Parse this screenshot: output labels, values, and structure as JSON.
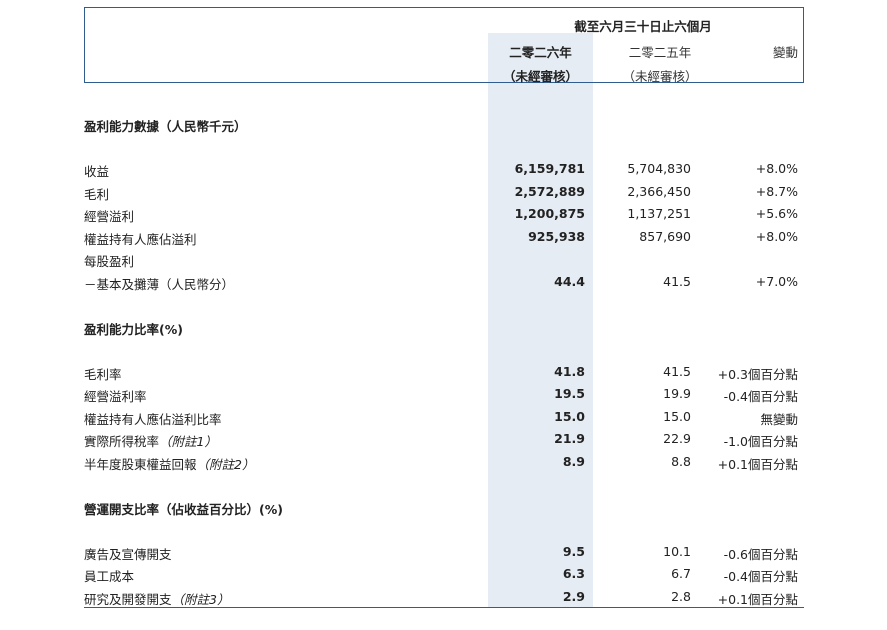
{
  "header": {
    "period": "截至六月三十日止六個月",
    "col_current": "二零二六年",
    "col_current_sub": "（未經審核）",
    "col_prior": "二零二五年",
    "col_prior_sub": "（未經審核）",
    "col_change": "變動"
  },
  "sections": [
    {
      "title": "盈利能力數據（人民幣千元）",
      "rows": [
        {
          "label": "收益",
          "note": "",
          "current": "6,159,781",
          "prior": "5,704,830",
          "change": "+8.0%"
        },
        {
          "label": "毛利",
          "note": "",
          "current": "2,572,889",
          "prior": "2,366,450",
          "change": "+8.7%"
        },
        {
          "label": "經營溢利",
          "note": "",
          "current": "1,200,875",
          "prior": "1,137,251",
          "change": "+5.6%"
        },
        {
          "label": "權益持有人應佔溢利",
          "note": "",
          "current": "925,938",
          "prior": "857,690",
          "change": "+8.0%"
        },
        {
          "label": "每股盈利",
          "note": "",
          "current": "",
          "prior": "",
          "change": ""
        },
        {
          "label": "－基本及攤薄（人民幣分）",
          "note": "",
          "current": "44.4",
          "prior": "41.5",
          "change": "+7.0%"
        }
      ]
    },
    {
      "title": "盈利能力比率(%)",
      "rows": [
        {
          "label": "毛利率",
          "note": "",
          "current": "41.8",
          "prior": "41.5",
          "change": "+0.3個百分點"
        },
        {
          "label": "經營溢利率",
          "note": "",
          "current": "19.5",
          "prior": "19.9",
          "change": "-0.4個百分點"
        },
        {
          "label": "權益持有人應佔溢利比率",
          "note": "",
          "current": "15.0",
          "prior": "15.0",
          "change": "無變動"
        },
        {
          "label": "實際所得稅率",
          "note": "（附註1）",
          "current": "21.9",
          "prior": "22.9",
          "change": "-1.0個百分點"
        },
        {
          "label": "半年度股東權益回報",
          "note": "（附註2）",
          "current": "8.9",
          "prior": "8.8",
          "change": "+0.1個百分點"
        }
      ]
    },
    {
      "title": "營運開支比率（佔收益百分比）(%)",
      "rows": [
        {
          "label": "廣告及宣傳開支",
          "note": "",
          "current": "9.5",
          "prior": "10.1",
          "change": "-0.6個百分點"
        },
        {
          "label": "員工成本",
          "note": "",
          "current": "6.3",
          "prior": "6.7",
          "change": "-0.4個百分點"
        },
        {
          "label": "研究及開發開支",
          "note": "（附註3）",
          "current": "2.9",
          "prior": "2.8",
          "change": "+0.1個百分點"
        }
      ]
    }
  ]
}
